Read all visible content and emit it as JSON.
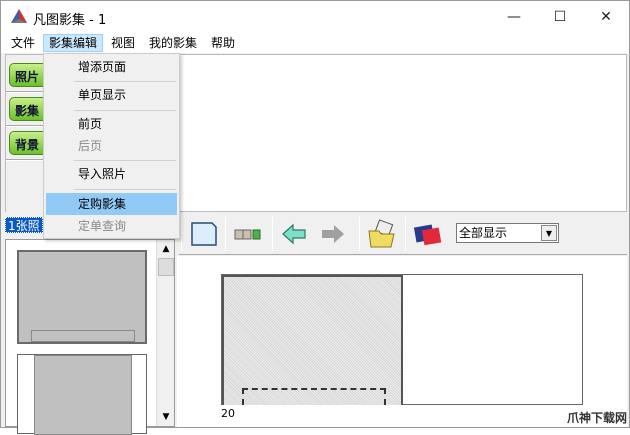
{
  "window": {
    "title": "凡图影集 - 1",
    "minimize": "—",
    "maximize": "☐",
    "close": "✕"
  },
  "menubar": [
    "文件",
    "影集编辑",
    "视图",
    "我的影集",
    "帮助"
  ],
  "dropdown": {
    "items": [
      {
        "label": "增添页面"
      },
      {
        "label": "单页显示"
      },
      {
        "label": "前页"
      },
      {
        "label": "后页",
        "disabled": true
      },
      {
        "label": "导入照片"
      },
      {
        "label": "定购影集",
        "highlighted": true
      },
      {
        "label": "定单查询",
        "disabled": true
      }
    ]
  },
  "left_tabs": [
    "照片",
    "影集",
    "背景"
  ],
  "photo_count": "1张照",
  "toolbar": {
    "display_select": "全部显示"
  },
  "canvas": {
    "page_number": "20"
  },
  "watermark": "爪神下载网"
}
